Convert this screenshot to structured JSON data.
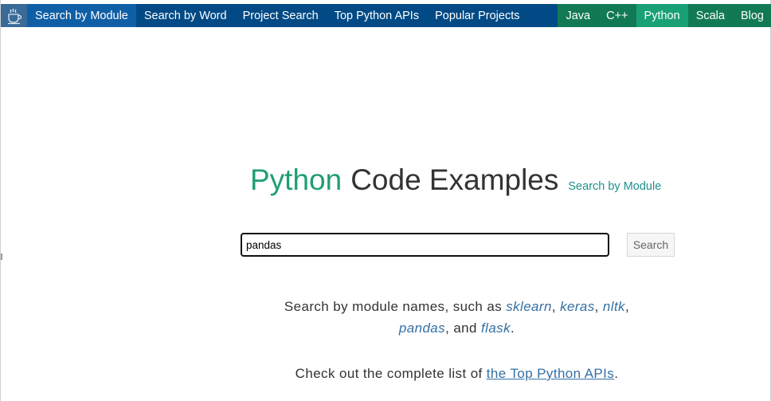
{
  "navbar": {
    "logo_icon": "coffee-cup-icon",
    "left_items": [
      {
        "label": "Search by Module",
        "active": true
      },
      {
        "label": "Search by Word",
        "active": false
      },
      {
        "label": "Project Search",
        "active": false
      },
      {
        "label": "Top Python APIs",
        "active": false
      },
      {
        "label": "Popular Projects",
        "active": false
      }
    ],
    "right_items": [
      {
        "label": "Java",
        "active": false
      },
      {
        "label": "C++",
        "active": false
      },
      {
        "label": "Python",
        "active": true
      },
      {
        "label": "Scala",
        "active": false
      },
      {
        "label": "Blog",
        "active": false
      }
    ]
  },
  "main": {
    "title_lang": "Python",
    "title_rest": "Code Examples",
    "title_link": "Search by Module",
    "search": {
      "value": "pandas",
      "button_label": "Search"
    },
    "hint_modules": {
      "prefix": "Search by module names, such as ",
      "modules": [
        "sklearn",
        "keras",
        "nltk",
        "pandas",
        "flask"
      ],
      "sep1": ", ",
      "sep2": ", ",
      "sep3": ",",
      "sep4": ", and ",
      "suffix": "."
    },
    "hint_apis": {
      "prefix": "Check out the complete list of ",
      "link": "the Top Python APIs",
      "suffix": "."
    }
  },
  "colors": {
    "nav_bg": "#014a85",
    "nav_active": "#0f5fa6",
    "lang_bg": "#117a55",
    "lang_active": "#1aa076",
    "title_green": "#1f9f71",
    "link_blue": "#346fa4"
  }
}
